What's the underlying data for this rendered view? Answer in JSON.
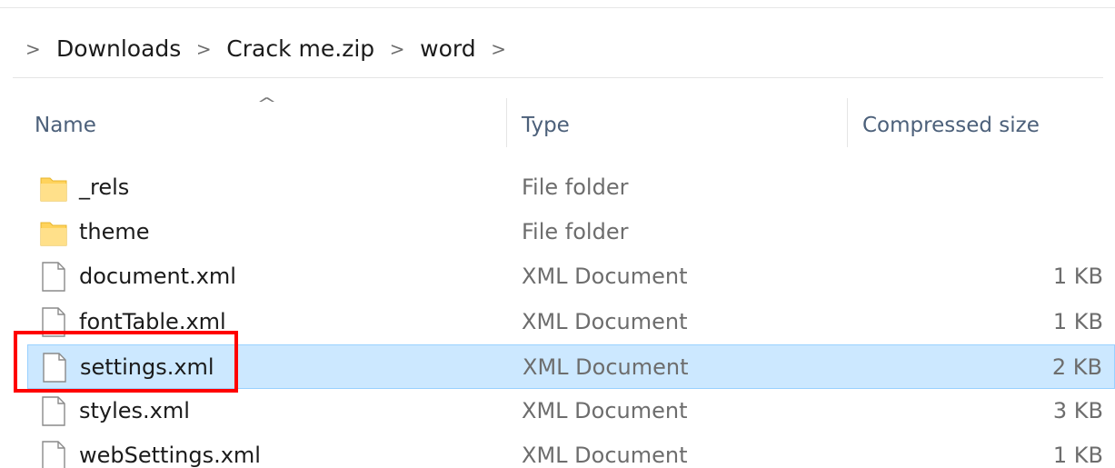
{
  "breadcrumb": {
    "items": [
      "Downloads",
      "Crack me.zip",
      "word"
    ],
    "separator": ">"
  },
  "columns": {
    "sort_indicator": "^",
    "name": "Name",
    "type": "Type",
    "size": "Compressed size"
  },
  "files": [
    {
      "name": "_rels",
      "type": "File folder",
      "size": "",
      "icon": "folder-icon"
    },
    {
      "name": "theme",
      "type": "File folder",
      "size": "",
      "icon": "folder-icon"
    },
    {
      "name": "document.xml",
      "type": "XML Document",
      "size": "1 KB",
      "icon": "file-icon"
    },
    {
      "name": "fontTable.xml",
      "type": "XML Document",
      "size": "1 KB",
      "icon": "file-icon"
    },
    {
      "name": "settings.xml",
      "type": "XML Document",
      "size": "2 KB",
      "icon": "file-icon",
      "selected": true
    },
    {
      "name": "styles.xml",
      "type": "XML Document",
      "size": "3 KB",
      "icon": "file-icon"
    },
    {
      "name": "webSettings.xml",
      "type": "XML Document",
      "size": "1 KB",
      "icon": "file-icon"
    }
  ],
  "colors": {
    "selection_bg": "#cce8ff",
    "selection_border": "#99d1ff",
    "highlight": "#ff0000",
    "folder": "#ffd35c"
  }
}
